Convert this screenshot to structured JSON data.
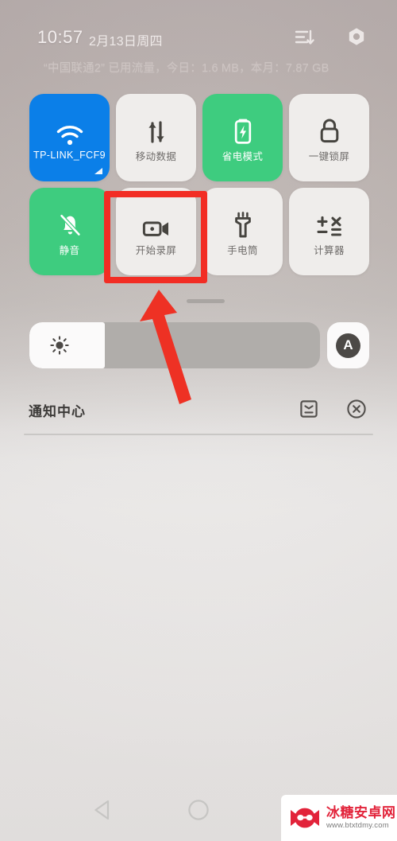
{
  "status_bar": {
    "time": "10:57",
    "date": "2月13日周四",
    "traffic_info": "“中国联通2” 已用流量，今日：1.6 MB，本月：7.87 GB",
    "icons": [
      {
        "name": "sort-list-icon",
        "label": "排序"
      },
      {
        "name": "settings-gear-icon",
        "label": "设置"
      }
    ]
  },
  "quick_settings": {
    "rows": [
      [
        {
          "label": "TP-LINK_FCF9",
          "icon": "wifi-icon",
          "state": "on",
          "style": "wifi"
        },
        {
          "label": "移动数据",
          "icon": "mobile-data-icon",
          "state": "off",
          "style": "off"
        },
        {
          "label": "省电模式",
          "icon": "battery-saver-icon",
          "state": "on",
          "style": "green"
        },
        {
          "label": "一键锁屏",
          "icon": "lock-icon",
          "state": "off",
          "style": "off"
        }
      ],
      [
        {
          "label": "静音",
          "icon": "bell-mute-icon",
          "state": "on",
          "style": "green"
        },
        {
          "label": "开始录屏",
          "icon": "screen-record-icon",
          "state": "off",
          "style": "off"
        },
        {
          "label": "手电筒",
          "icon": "flashlight-icon",
          "state": "off",
          "style": "off"
        },
        {
          "label": "计算器",
          "icon": "calculator-icon",
          "state": "off",
          "style": "off"
        }
      ]
    ]
  },
  "brightness": {
    "icon": "brightness-sun-icon",
    "value_percent": 26,
    "auto_label": "A"
  },
  "notification_center": {
    "title": "通知中心",
    "actions": [
      {
        "name": "notification-settings-icon",
        "label": "通知设置"
      },
      {
        "name": "clear-all-icon",
        "label": "清除全部"
      }
    ]
  },
  "nav_bar": {
    "back_label": "返回",
    "home_label": "主页"
  },
  "annotations": {
    "highlight_target": "开始录屏",
    "highlight_color": "#f22d24",
    "arrow_color": "#ee3124"
  },
  "watermark": {
    "site_name": "冰糖安卓网",
    "url": "www.btxtdmy.com"
  }
}
